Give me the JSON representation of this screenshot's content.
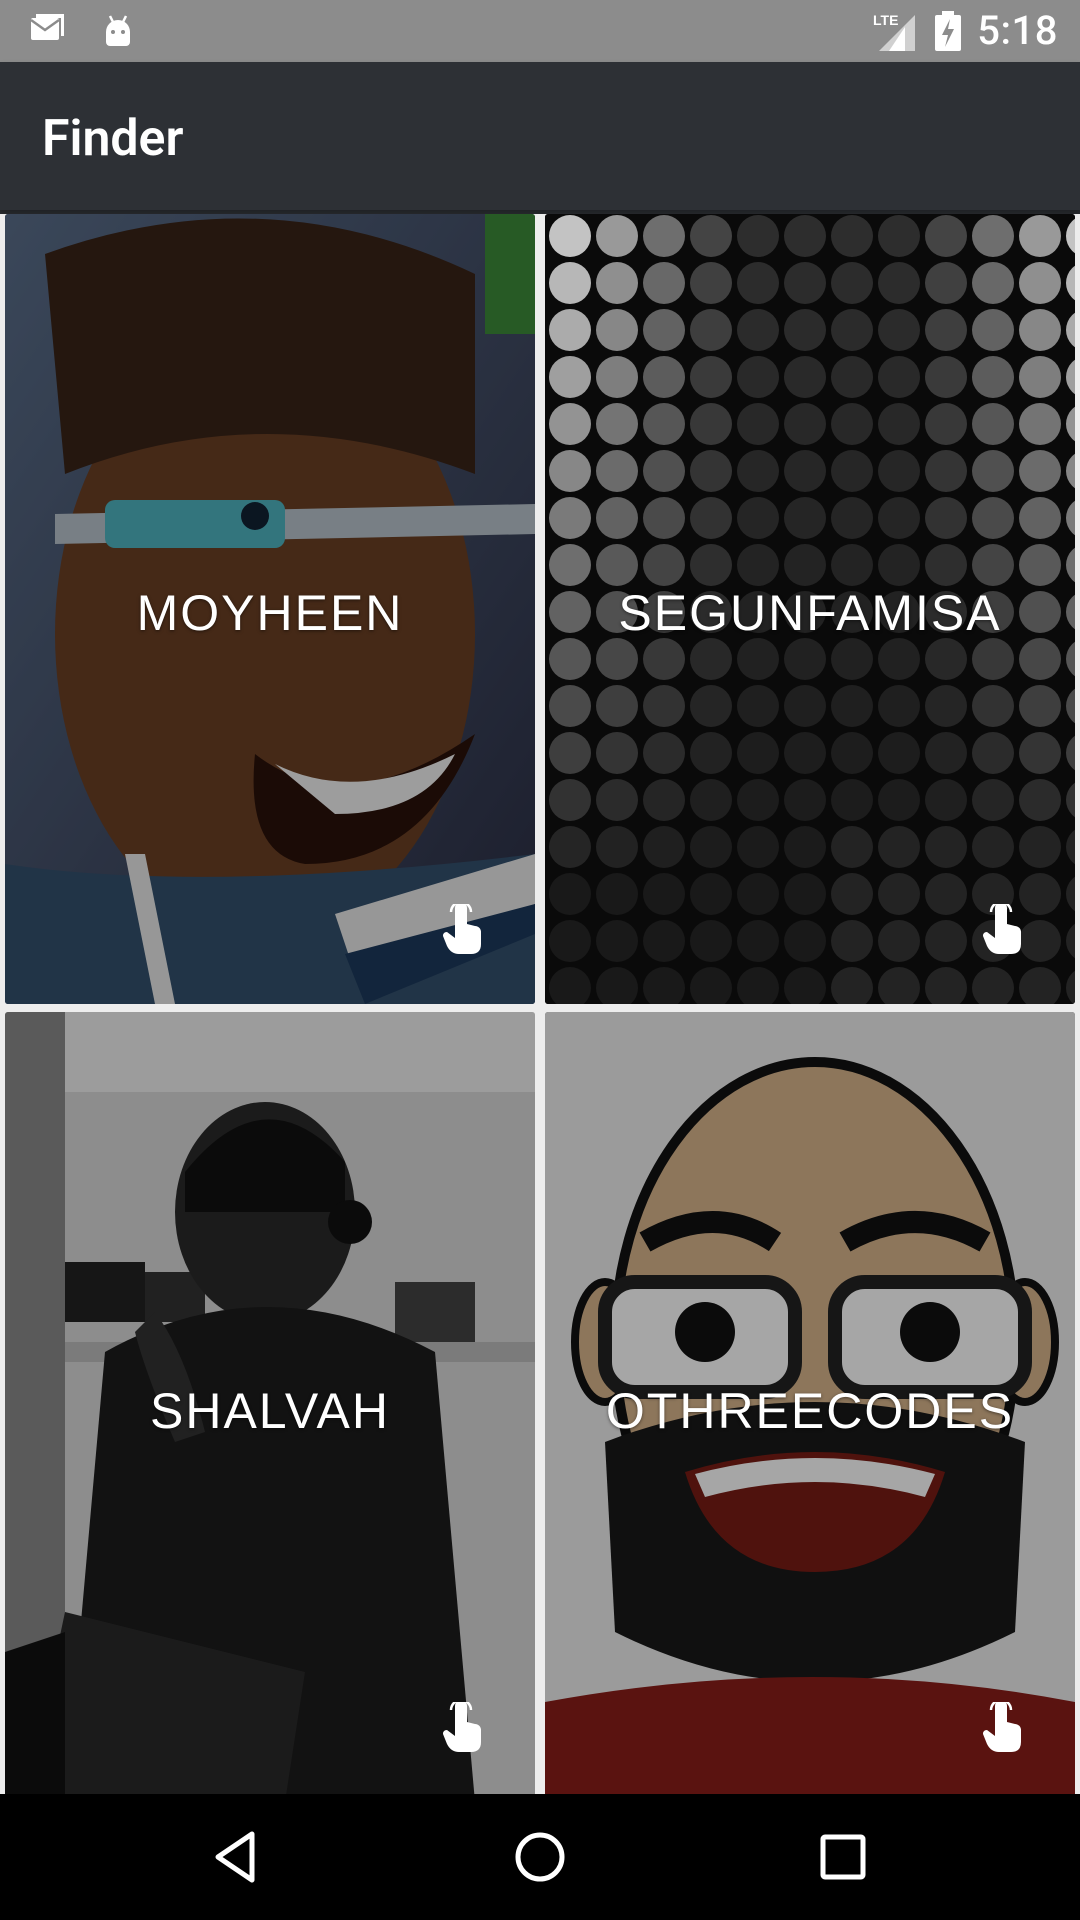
{
  "status_bar": {
    "time": "5:18",
    "network": "LTE",
    "icons": [
      "mail-icon",
      "android-icon",
      "signal-icon",
      "battery-charging-icon"
    ]
  },
  "app_bar": {
    "title": "Finder"
  },
  "cards": [
    {
      "name": "MOYHEEN",
      "image": "portrait-woman-glasses",
      "action_icon": "tap-icon"
    },
    {
      "name": "SEGUNFAMISA",
      "image": "dot-pattern",
      "action_icon": "tap-icon"
    },
    {
      "name": "SHALVAH",
      "image": "portrait-man-headphones",
      "action_icon": "tap-icon"
    },
    {
      "name": "OTHREECODES",
      "image": "cartoon-avatar",
      "action_icon": "tap-icon"
    }
  ],
  "nav_bar": {
    "buttons": [
      "back-icon",
      "home-icon",
      "recents-icon"
    ]
  }
}
